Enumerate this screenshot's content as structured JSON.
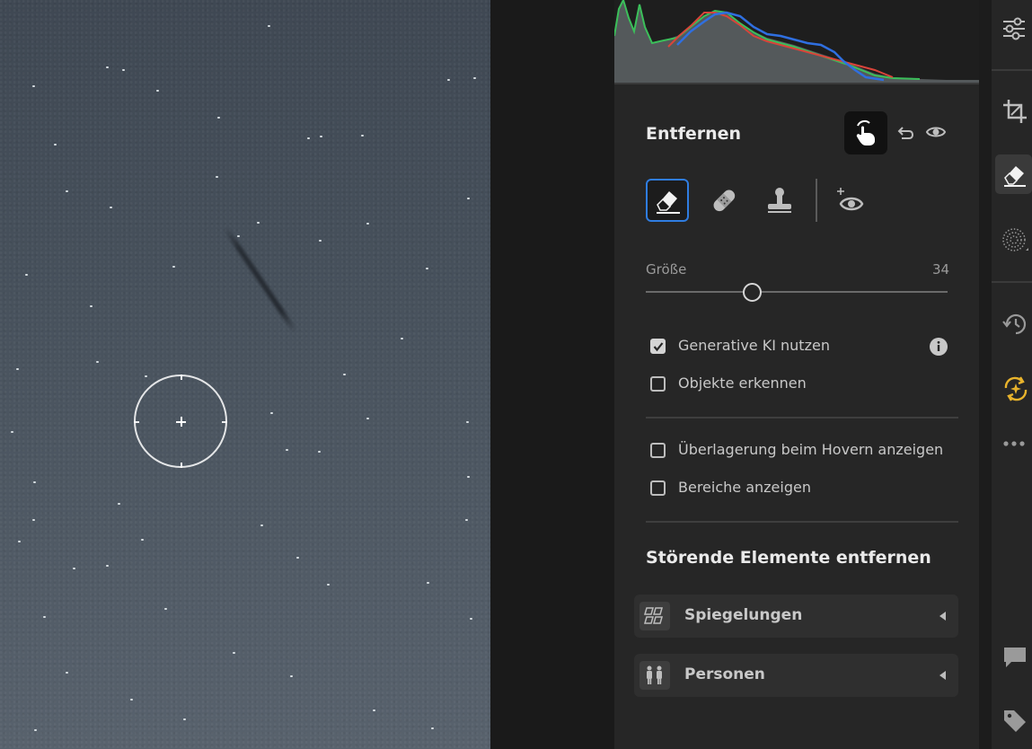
{
  "panel": {
    "remove_title": "Entfernen",
    "size_label": "Größe",
    "size_value": "34",
    "checkboxes": {
      "generative_ai": {
        "label": "Generative KI nutzen",
        "checked": true
      },
      "detect_objects": {
        "label": "Objekte erkennen",
        "checked": false
      },
      "show_overlay": {
        "label": "Überlagerung beim Hovern anzeigen",
        "checked": false
      },
      "show_areas": {
        "label": "Bereiche anzeigen",
        "checked": false
      }
    },
    "distractions_title": "Störende Elemente entfernen",
    "expanders": {
      "reflections": {
        "label": "Spiegelungen",
        "icon": "reflections-icon"
      },
      "people": {
        "label": "Personen",
        "icon": "people-icon"
      }
    },
    "tools": [
      "eraser-icon",
      "bandage-icon",
      "clone-stamp-icon",
      "red-eye-icon"
    ],
    "accent_color": "#2f7de1"
  },
  "toolstrip": {
    "items": [
      "sliders-icon",
      "crop-icon",
      "eraser-icon",
      "mask-icon",
      "history-icon",
      "ai-sparkle-icon",
      "more-icon",
      "comment-icon",
      "tag-icon"
    ],
    "active": "eraser-icon",
    "ai_color": "#e8b32c"
  }
}
